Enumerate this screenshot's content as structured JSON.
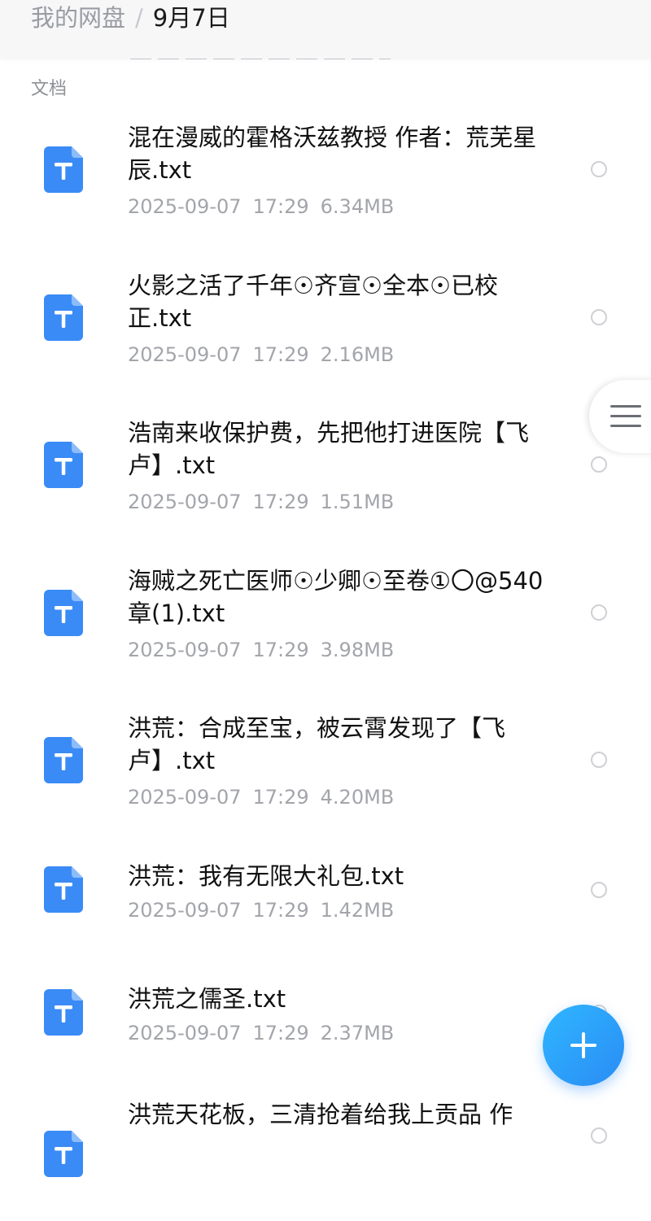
{
  "breadcrumb": {
    "root": "我的网盘",
    "separator": "/",
    "current": "9月7日"
  },
  "section_title": "文档",
  "icon_color": "#3a8bf6",
  "files": [
    {
      "name": "混在漫威的霍格沃兹教授 作者：荒芜星辰.txt",
      "date": "2025-09-07",
      "time": "17:29",
      "size": "6.34MB"
    },
    {
      "name": "火影之活了千年☉齐宣☉全本☉已校正.txt",
      "date": "2025-09-07",
      "time": "17:29",
      "size": "2.16MB"
    },
    {
      "name": "浩南来收保护费，先把他打进医院【飞卢】.txt",
      "date": "2025-09-07",
      "time": "17:29",
      "size": "1.51MB"
    },
    {
      "name": "海贼之死亡医师☉少卿☉至卷①〇@540章(1).txt",
      "date": "2025-09-07",
      "time": "17:29",
      "size": "3.98MB"
    },
    {
      "name": "洪荒：合成至宝，被云霄发现了【飞卢】.txt",
      "date": "2025-09-07",
      "time": "17:29",
      "size": "4.20MB"
    },
    {
      "name": "洪荒：我有无限大礼包.txt",
      "date": "2025-09-07",
      "time": "17:29",
      "size": "1.42MB"
    },
    {
      "name": "洪荒之儒圣.txt",
      "date": "2025-09-07",
      "time": "17:29",
      "size": "2.37MB"
    },
    {
      "name": "洪荒天花板，三清抢着给我上贡品 作",
      "date": "",
      "time": "",
      "size": ""
    }
  ]
}
